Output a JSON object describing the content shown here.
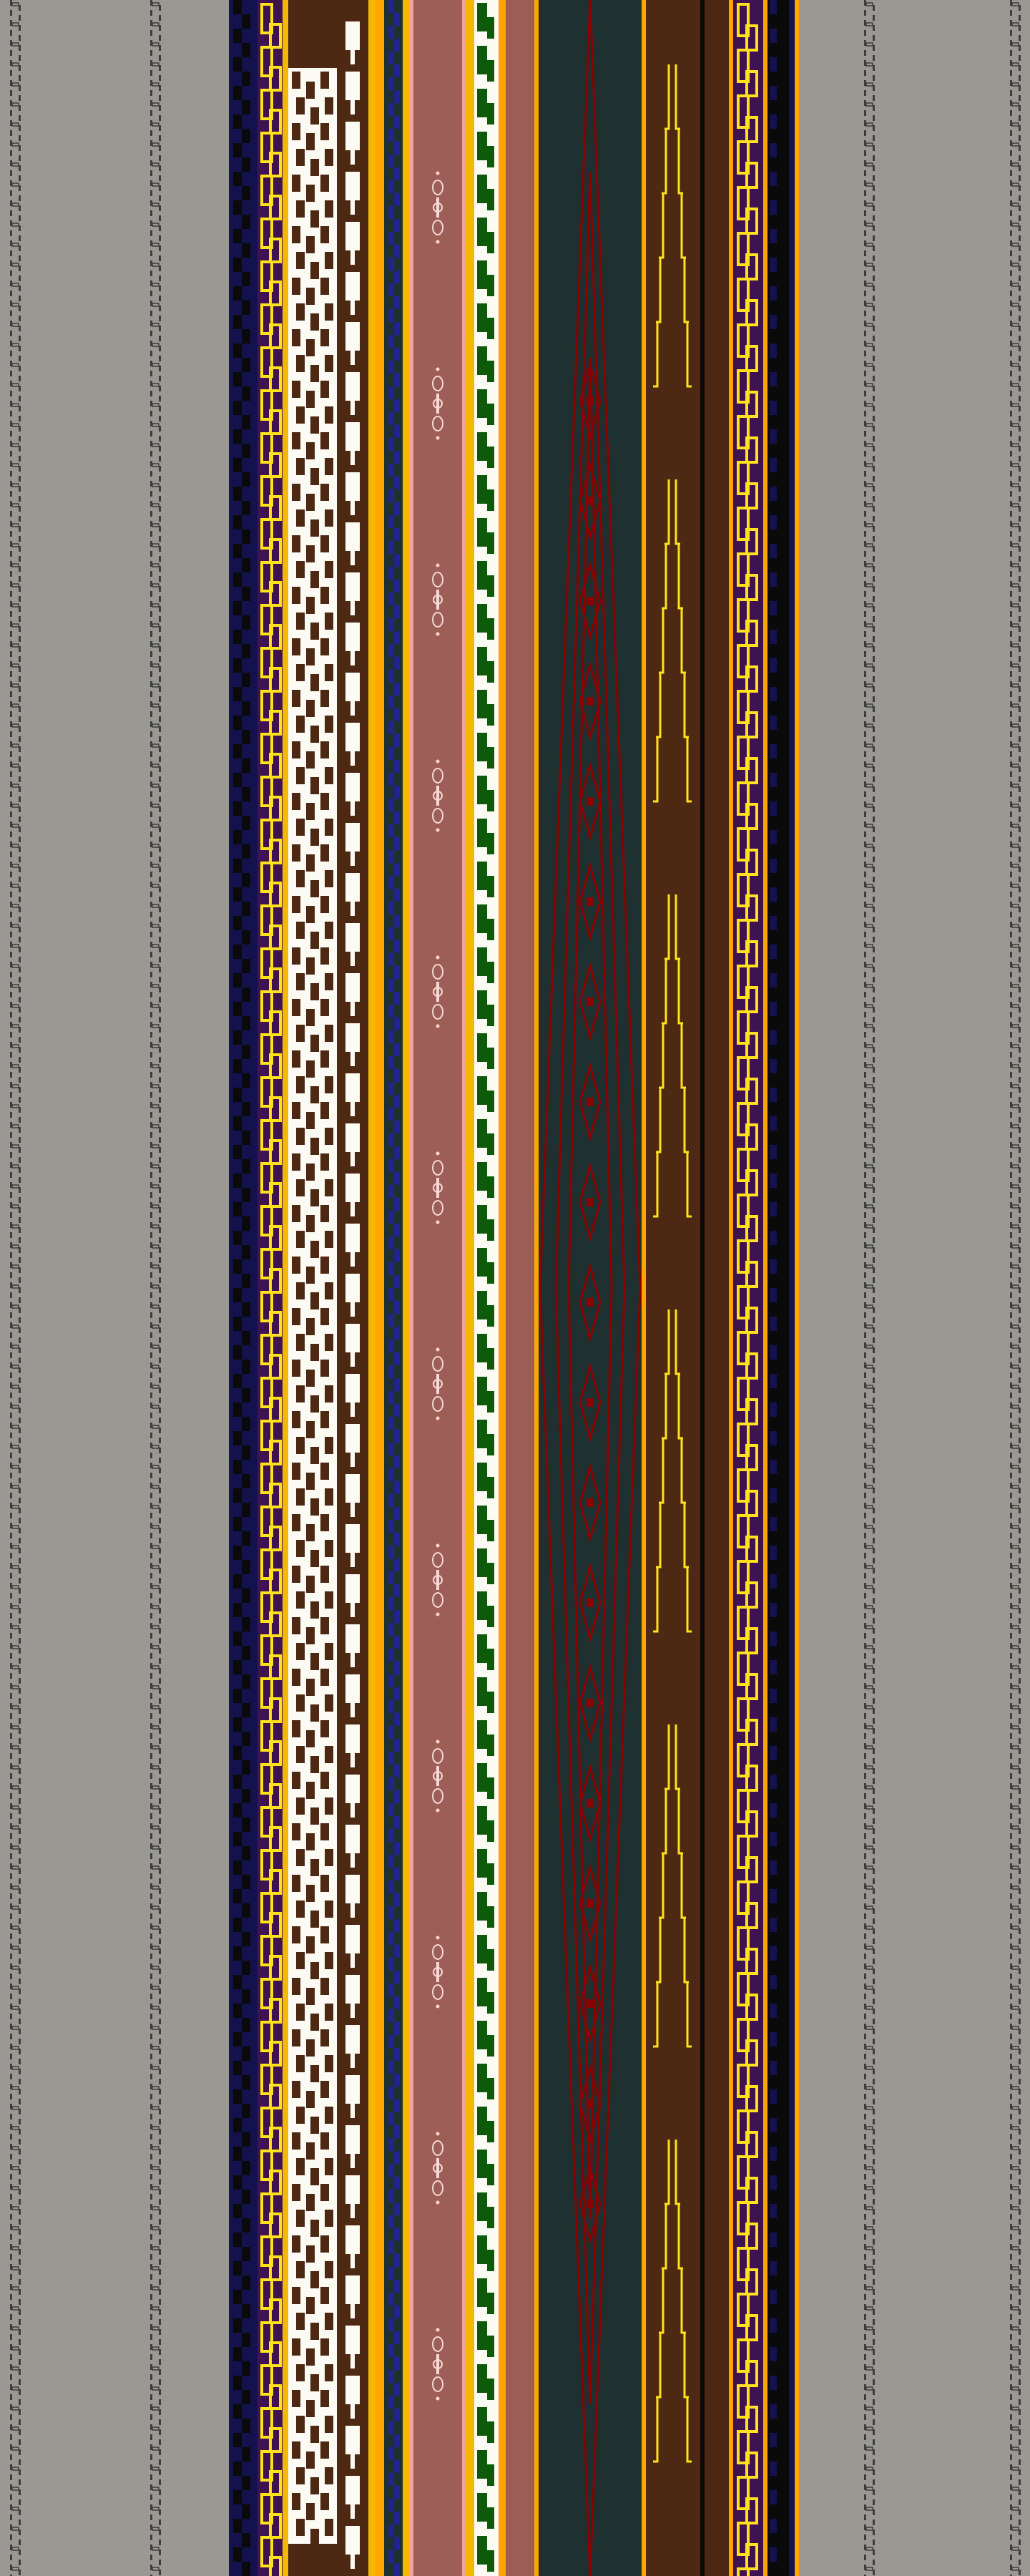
{
  "artwork": {
    "kind": "ikat-style woven textile stripe pattern",
    "palette": {
      "background_gray": "#9a9892",
      "chain_dark": "#3d3d3d",
      "navy": "#14124e",
      "black": "#0a0a0a",
      "gold": "#f4b800",
      "yellow_chain": "#ffe21a",
      "cream": "#fbfaf3",
      "chocolate": "#4d2812",
      "rose": "#9e5e58",
      "rose_border": "#f2a2a0",
      "green": "#0d5a0b",
      "deep_teal": "#1e3030",
      "crimson": "#8c0000",
      "purple": "#3f1252",
      "blue_chain": "#21248c",
      "orange_gold": "#ffa500"
    },
    "icons": {
      "left_edge": "chain-stitch-icon",
      "motif": "ornamental-medallion-icon",
      "diamond": "diamond-lattice-icon"
    }
  }
}
